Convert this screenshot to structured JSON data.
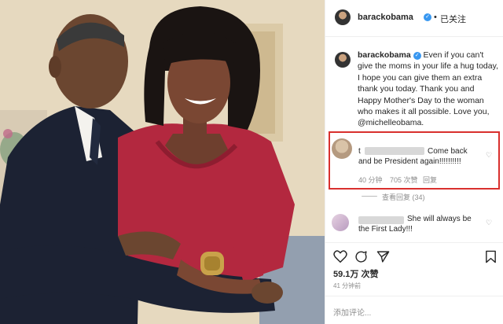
{
  "post": {
    "username": "barackobama",
    "follow_label": "已关注",
    "separator": "•",
    "caption": {
      "username": "barackobama",
      "text": "Even if you can't give the moms in your life a hug today, I hope you can give them an extra thank you today. Thank you and Happy Mother's Day to the woman who makes it all possible. Love you, @michelleobama."
    },
    "comments": [
      {
        "user_prefix": "t",
        "text_line1": "Come back",
        "text_line2": "and be President again!!!!!!!!!!",
        "time": "40 分钟",
        "likes": "705 次赞",
        "reply": "回复",
        "view_replies": "查看回复 (34)"
      },
      {
        "text_line1": "She will always be",
        "text_line2": "the First Lady!!!"
      }
    ],
    "likes": "59.1万 次赞",
    "time": "41 分钟前",
    "add_comment_placeholder": "添加评论..."
  },
  "icons": {
    "like": "heart-icon",
    "comment": "comment-icon",
    "share": "share-icon",
    "save": "bookmark-icon",
    "verified": "verified-badge-icon"
  },
  "colors": {
    "verified": "#3897f0",
    "highlight_border": "#d9302e",
    "dress": "#b3283f"
  }
}
